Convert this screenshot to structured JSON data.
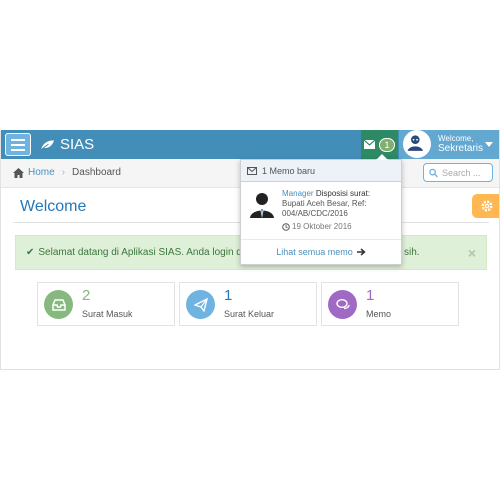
{
  "navbar": {
    "brand": "SIAS",
    "messages_badge": "1",
    "user": {
      "greeting": "Welcome,",
      "name": "Sekretaris"
    }
  },
  "breadcrumbs": {
    "home": "Home",
    "current": "Dashboard"
  },
  "search": {
    "placeholder": "Search ..."
  },
  "page": {
    "title": "Welcome"
  },
  "alert": {
    "text": "Selamat datang di Aplikasi SIAS. Anda login der",
    "text_tail": "sih.",
    "close": "×"
  },
  "cards": [
    {
      "value": "2",
      "label": "Surat Masuk",
      "color": "#87b87f",
      "num_color": "#87b87f"
    },
    {
      "value": "1",
      "label": "Surat Keluar",
      "color": "#6fb3e0",
      "num_color": "#2679b5"
    },
    {
      "value": "1",
      "label": "Memo",
      "color": "#a069c3",
      "num_color": "#a069c3"
    }
  ],
  "dropdown": {
    "header": "1 Memo baru",
    "item": {
      "sender": "Manager",
      "subject_title": "Disposisi surat:",
      "subject_line1": "Bupati Aceh Besar, Ref:",
      "subject_line2": "004/AB/CDC/2016",
      "date": "19 Oktober 2016"
    },
    "footer": "Lihat semua memo"
  }
}
